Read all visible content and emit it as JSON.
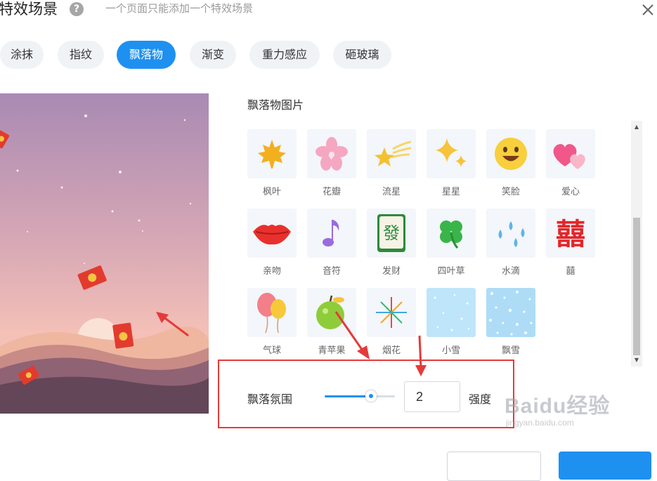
{
  "header": {
    "title": "特效场景",
    "help_glyph": "?",
    "subtitle": "一个页面只能添加一个特效场景"
  },
  "tabs": [
    {
      "label": "涂抹",
      "active": false
    },
    {
      "label": "指纹",
      "active": false
    },
    {
      "label": "飘落物",
      "active": true
    },
    {
      "label": "渐变",
      "active": false
    },
    {
      "label": "重力感应",
      "active": false
    },
    {
      "label": "砸玻璃",
      "active": false
    }
  ],
  "section_title": "飘落物图片",
  "items": [
    {
      "label": "枫叶",
      "icon": "maple-leaf-icon"
    },
    {
      "label": "花瓣",
      "icon": "petal-icon"
    },
    {
      "label": "流星",
      "icon": "shooting-star-icon"
    },
    {
      "label": "星星",
      "icon": "sparkle-star-icon"
    },
    {
      "label": "笑脸",
      "icon": "smiley-icon"
    },
    {
      "label": "爱心",
      "icon": "hearts-icon"
    },
    {
      "label": "亲吻",
      "icon": "lips-icon"
    },
    {
      "label": "音符",
      "icon": "music-note-icon"
    },
    {
      "label": "发财",
      "icon": "mahjong-tile-icon",
      "glyph": "發"
    },
    {
      "label": "四叶草",
      "icon": "clover-icon"
    },
    {
      "label": "水滴",
      "icon": "water-drops-icon"
    },
    {
      "label": "囍",
      "icon": "double-happiness-icon",
      "glyph": "囍"
    },
    {
      "label": "气球",
      "icon": "balloons-icon"
    },
    {
      "label": "青苹果",
      "icon": "green-apple-icon"
    },
    {
      "label": "烟花",
      "icon": "fireworks-icon"
    },
    {
      "label": "小雪",
      "icon": "light-snow-icon"
    },
    {
      "label": "飘雪",
      "icon": "heavy-snow-icon"
    }
  ],
  "atmosphere": {
    "label": "飘落氛围",
    "slider_level": 0.66,
    "value": "2",
    "strength_label": "强度"
  },
  "watermark": {
    "text": "Baidu经验",
    "url": "jingyan.baidu.com"
  },
  "colors": {
    "accent": "#1e90f0",
    "highlight_box": "#e53a3a"
  }
}
